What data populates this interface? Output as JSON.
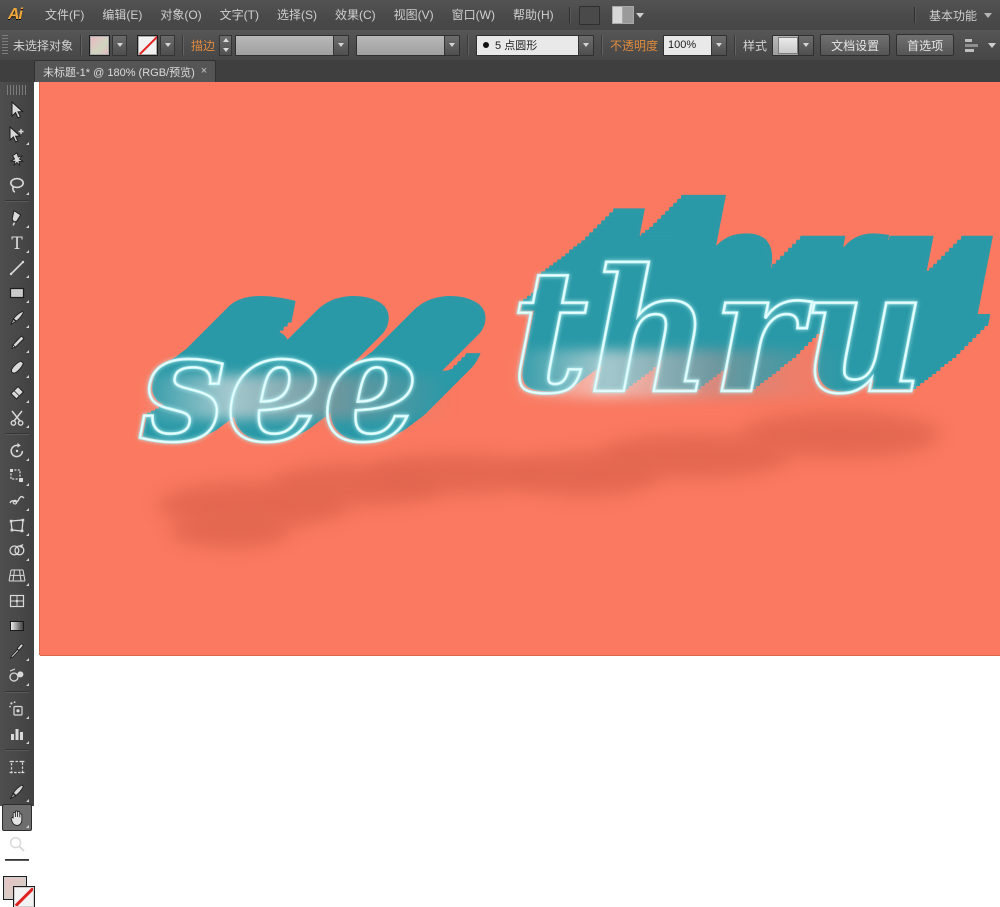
{
  "app": {
    "name": "Adobe Illustrator",
    "logo_text": "Ai"
  },
  "menubar": {
    "items": [
      {
        "label": "文件(F)",
        "name": "menu-file"
      },
      {
        "label": "编辑(E)",
        "name": "menu-edit"
      },
      {
        "label": "对象(O)",
        "name": "menu-object"
      },
      {
        "label": "文字(T)",
        "name": "menu-type"
      },
      {
        "label": "选择(S)",
        "name": "menu-select"
      },
      {
        "label": "效果(C)",
        "name": "menu-effect"
      },
      {
        "label": "视图(V)",
        "name": "menu-view"
      },
      {
        "label": "窗口(W)",
        "name": "menu-window"
      },
      {
        "label": "帮助(H)",
        "name": "menu-help"
      }
    ],
    "bridge_icon": "bridge-icon",
    "arrange_documents_icon": "arrange-documents-icon",
    "workspace_label": "基本功能"
  },
  "controlbar": {
    "selection_status": "未选择对象",
    "fill_swatch": "fill-swatch-gradient",
    "stroke_swatch": "stroke-swatch-none",
    "stroke_label": "描边",
    "stroke_weight_value": "",
    "stroke_profile_value": "",
    "brush_value": "5 点圆形",
    "opacity_label": "不透明度",
    "opacity_value": "100%",
    "style_label": "样式",
    "document_setup_label": "文档设置",
    "preferences_label": "首选项",
    "align_icon": "align-panel-icon"
  },
  "tabbar": {
    "document_tab": "未标题-1* @ 180% (RGB/预览)",
    "close_glyph": "×"
  },
  "toolbox": {
    "tools": [
      {
        "name": "selection-tool",
        "label": "选择工具",
        "selected": false
      },
      {
        "name": "direct-selection-tool",
        "label": "直接选择工具",
        "selected": false
      },
      {
        "name": "magic-wand-tool",
        "label": "魔棒工具",
        "selected": false
      },
      {
        "name": "lasso-tool",
        "label": "套索工具",
        "selected": false
      },
      {
        "name": "pen-tool",
        "label": "钢笔工具",
        "selected": false
      },
      {
        "name": "type-tool",
        "label": "文字工具",
        "selected": false
      },
      {
        "name": "line-segment-tool",
        "label": "直线段工具",
        "selected": false
      },
      {
        "name": "rectangle-tool",
        "label": "矩形工具",
        "selected": false
      },
      {
        "name": "paintbrush-tool",
        "label": "画笔工具",
        "selected": false
      },
      {
        "name": "pencil-tool",
        "label": "铅笔工具",
        "selected": false
      },
      {
        "name": "blob-brush-tool",
        "label": "斑点画笔工具",
        "selected": false
      },
      {
        "name": "eraser-tool",
        "label": "橡皮擦工具",
        "selected": false
      },
      {
        "name": "scissors-tool",
        "label": "剪刀工具",
        "selected": false
      },
      {
        "name": "rotate-tool",
        "label": "旋转工具",
        "selected": false
      },
      {
        "name": "scale-tool",
        "label": "比例缩放工具",
        "selected": false
      },
      {
        "name": "width-tool",
        "label": "宽度工具",
        "selected": false
      },
      {
        "name": "free-transform-tool",
        "label": "自由变换工具",
        "selected": false
      },
      {
        "name": "shape-builder-tool",
        "label": "形状生成器工具",
        "selected": false
      },
      {
        "name": "perspective-grid-tool",
        "label": "透视网格工具",
        "selected": false
      },
      {
        "name": "mesh-tool",
        "label": "网格工具",
        "selected": false
      },
      {
        "name": "gradient-tool",
        "label": "渐变工具",
        "selected": false
      },
      {
        "name": "eyedropper-tool",
        "label": "吸管工具",
        "selected": false
      },
      {
        "name": "blend-tool",
        "label": "混合工具",
        "selected": false
      },
      {
        "name": "symbol-sprayer-tool",
        "label": "符号喷枪工具",
        "selected": false
      },
      {
        "name": "column-graph-tool",
        "label": "柱形图工具",
        "selected": false
      },
      {
        "name": "artboard-tool",
        "label": "画板工具",
        "selected": false
      },
      {
        "name": "slice-tool",
        "label": "切片工具",
        "selected": false
      },
      {
        "name": "hand-tool",
        "label": "抓手工具",
        "selected": true
      },
      {
        "name": "zoom-tool",
        "label": "缩放工具",
        "selected": false
      }
    ],
    "fill_color": "#E8C3C6",
    "stroke_color": "none"
  },
  "canvas": {
    "background_color": "#FFFFFF",
    "artboard_color": "#FA7960",
    "zoom_level": "180%",
    "artwork": {
      "text_line_1": "see",
      "text_line_2": "thru",
      "face_stroke_color": "#BDF4F6",
      "extrude_color": "#2A9AA8",
      "shadow_color": "#E2664F"
    }
  }
}
